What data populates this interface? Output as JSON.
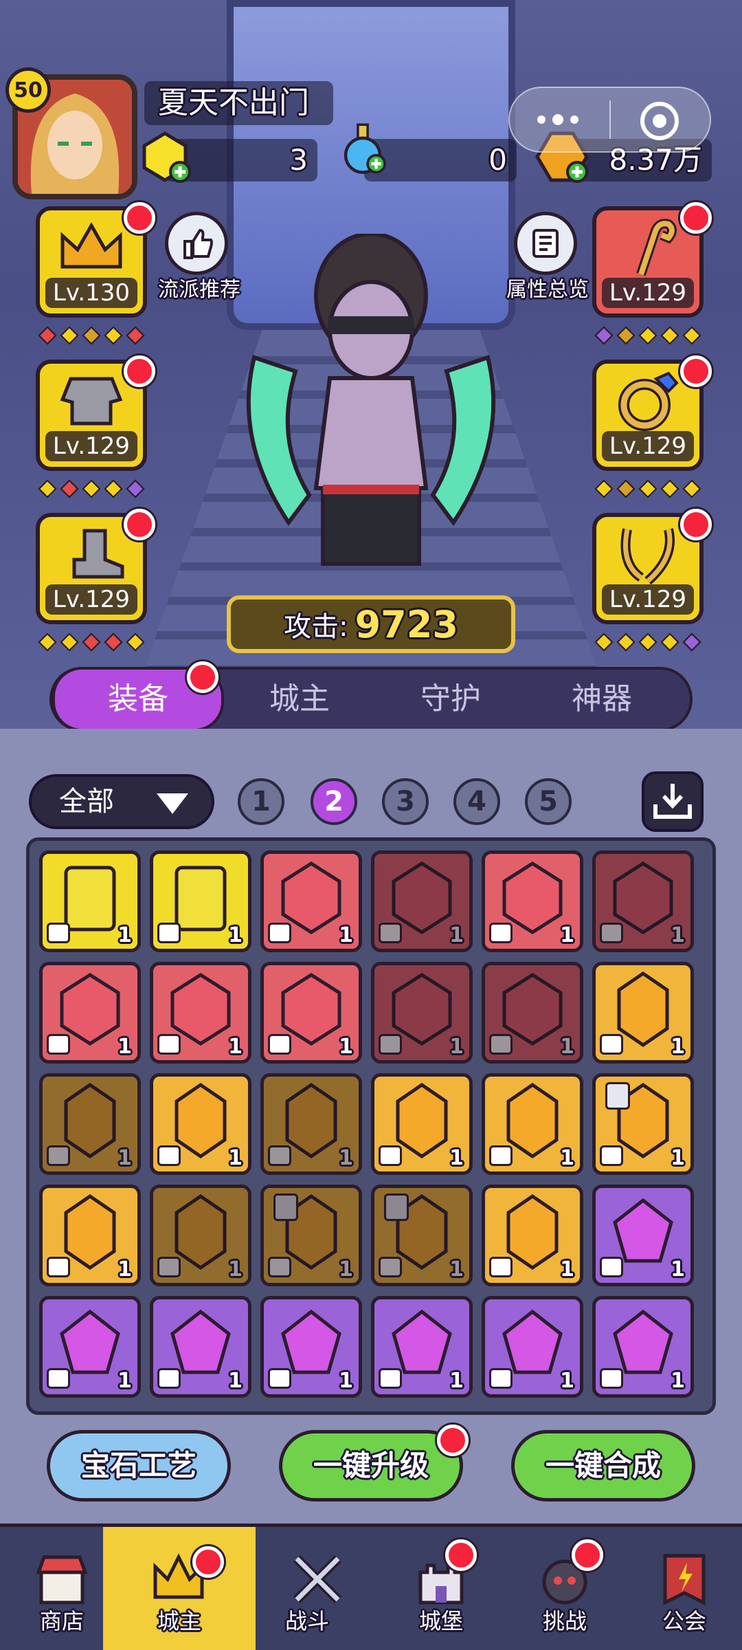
{
  "player": {
    "level": "50",
    "name": "夏天不出门"
  },
  "resources": [
    {
      "name": "gem-currency",
      "value": "3"
    },
    {
      "name": "potion",
      "value": "0"
    },
    {
      "name": "gold",
      "value": "8.37万"
    }
  ],
  "shortcuts": {
    "school": "流派推荐",
    "attributes": "属性总览"
  },
  "equipment": {
    "left": [
      {
        "name": "crown",
        "level": "Lv.130"
      },
      {
        "name": "armor",
        "level": "Lv.129"
      },
      {
        "name": "boots",
        "level": "Lv.129"
      }
    ],
    "right": [
      {
        "name": "staff",
        "level": "Lv.129"
      },
      {
        "name": "ring",
        "level": "Lv.129"
      },
      {
        "name": "necklace",
        "level": "Lv.129"
      }
    ]
  },
  "attack": {
    "label": "攻击:",
    "value": "9723"
  },
  "tabs": [
    "装备",
    "城主",
    "守护",
    "神器"
  ],
  "filter": {
    "label": "全部"
  },
  "pages": [
    "1",
    "2",
    "3",
    "4",
    "5"
  ],
  "inventory": {
    "rows": [
      [
        {
          "c": "yellow",
          "n": "1"
        },
        {
          "c": "yellow",
          "n": "1"
        },
        {
          "c": "red",
          "n": "1"
        },
        {
          "c": "red",
          "n": "1",
          "dim": true
        },
        {
          "c": "red",
          "n": "1"
        },
        {
          "c": "red",
          "n": "1",
          "dim": true
        }
      ],
      [
        {
          "c": "red",
          "n": "1"
        },
        {
          "c": "red",
          "n": "1"
        },
        {
          "c": "red",
          "n": "1"
        },
        {
          "c": "red",
          "n": "1",
          "dim": true
        },
        {
          "c": "red",
          "n": "1",
          "dim": true
        },
        {
          "c": "orange",
          "n": "1"
        }
      ],
      [
        {
          "c": "orange",
          "n": "1",
          "dim": true
        },
        {
          "c": "orange",
          "n": "1"
        },
        {
          "c": "orange",
          "n": "1",
          "dim": true
        },
        {
          "c": "orange",
          "n": "1"
        },
        {
          "c": "orange",
          "n": "1"
        },
        {
          "c": "orange",
          "n": "1",
          "lock": true
        }
      ],
      [
        {
          "c": "orange",
          "n": "1"
        },
        {
          "c": "orange",
          "n": "1",
          "dim": true
        },
        {
          "c": "orange",
          "n": "1",
          "dim": true,
          "lock": true
        },
        {
          "c": "orange",
          "n": "1",
          "dim": true,
          "lock": true
        },
        {
          "c": "orange",
          "n": "1"
        },
        {
          "c": "purple",
          "n": "1"
        }
      ],
      [
        {
          "c": "purple",
          "n": "1"
        },
        {
          "c": "purple",
          "n": "1"
        },
        {
          "c": "purple",
          "n": "1"
        },
        {
          "c": "purple",
          "n": "1"
        },
        {
          "c": "purple",
          "n": "1"
        },
        {
          "c": "purple",
          "n": "1"
        }
      ]
    ]
  },
  "actions": {
    "craft": "宝石工艺",
    "upgrade": "一键升级",
    "merge": "一键合成"
  },
  "nav": [
    {
      "label": "商店"
    },
    {
      "label": "城主"
    },
    {
      "label": "战斗"
    },
    {
      "label": "城堡"
    },
    {
      "label": "挑战"
    },
    {
      "label": "公会"
    }
  ],
  "colors": {
    "yellow": "#f1dc2a",
    "red": "#e2606a",
    "orange": "#f0b53a",
    "purple": "#9a63d8"
  }
}
